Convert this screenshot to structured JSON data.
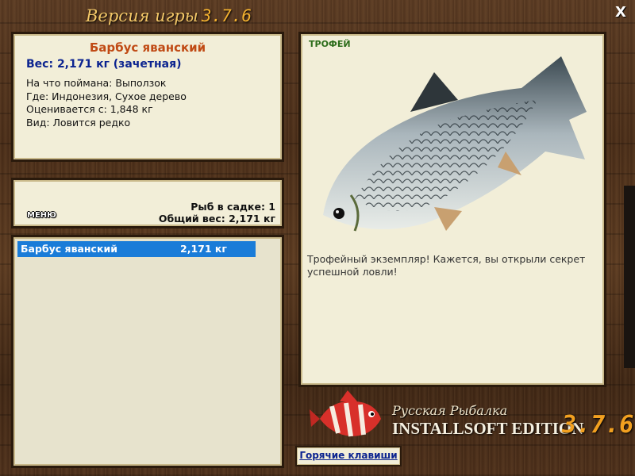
{
  "header": {
    "title": "Версия игры",
    "version": "3.7.6",
    "close_symbol": "X"
  },
  "fish_info": {
    "name": "Барбус яванский",
    "weight": "Вес: 2,171 кг (зачетная)",
    "rows": [
      "На что поймана: Выползок",
      "Где: Индонезия, Сухое дерево",
      "Оценивается с: 1,848 кг",
      "Вид: Ловится редко"
    ]
  },
  "keepnet": {
    "menu_label": "МЕНЮ",
    "count": "Рыб в садке: 1",
    "total_weight": "Общий вес: 2,171 кг"
  },
  "catch_list": [
    {
      "name": "Барбус яванский",
      "weight": "2,171 кг"
    }
  ],
  "photo_panel": {
    "badge": "ТРОФЕЙ",
    "description": "Трофейный экземпляр! Кажется, вы открыли секрет успешной ловли!"
  },
  "logo": {
    "line1": "Русская Рыбалка",
    "line2": "INSTALLSOFT EDITION",
    "version": "3.7.6"
  },
  "hotkeys_label": "Горячие клавиши",
  "colors": {
    "fish_name": "#c04a14",
    "weight": "#0c2490",
    "selection": "#1a7cd8",
    "trophy": "#2c6c1a",
    "version_accent": "#f2a020"
  }
}
